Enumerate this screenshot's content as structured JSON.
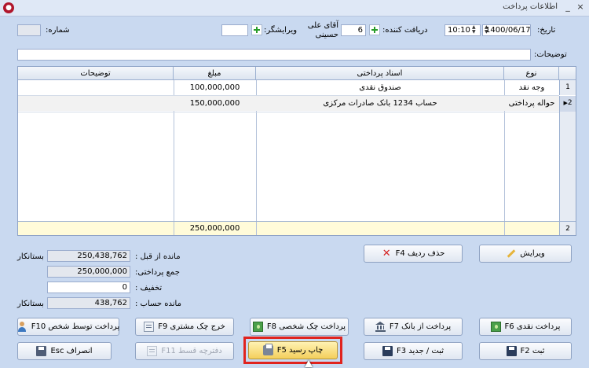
{
  "window": {
    "title": "اطلاعات پرداخت",
    "minimize": "_",
    "close": "×"
  },
  "header": {
    "number_label": "شماره:",
    "number_value": "",
    "editor_label": "ویرایشگر:",
    "editor_value": "",
    "receiver_label": "دریافت کننده:",
    "receiver_code": "6",
    "receiver_name_line1": "آقای علی",
    "receiver_name_line2": "حسینی",
    "date_label": "تاریخ:",
    "date_value": "1400/06/17",
    "time_value": "10:10",
    "description_label": "توضیحات:",
    "description_value": ""
  },
  "grid": {
    "columns": [
      "نوع",
      "اسناد پرداختی",
      "مبلغ",
      "توضیحات"
    ],
    "rows": [
      {
        "num": "1",
        "type": "وجه نقد",
        "doc": "صندوق نقدی",
        "amount": "100,000,000",
        "desc": ""
      },
      {
        "num": "2",
        "type": "حواله پرداختی",
        "doc": "حساب 1234 بانک صادرات مرکزی",
        "amount": "150,000,000",
        "desc": ""
      }
    ],
    "footer_count": "2",
    "footer_total": "250,000,000"
  },
  "summary": {
    "prev_balance_label": "مانده از قبل :",
    "prev_balance_value": "250,438,762",
    "prev_balance_status": "بستانکار",
    "total_paid_label": "جمع پرداختی:",
    "total_paid_value": "250,000,000",
    "discount_label": "تخفیف :",
    "discount_value": "0",
    "account_balance_label": "مانده حساب :",
    "account_balance_value": "438,762",
    "account_balance_status": "بستانکار"
  },
  "buttons": {
    "edit": "ویرایش",
    "delete_row": "حذف ردیف F4",
    "cash_payment": "پرداخت نقدی F6",
    "bank_payment": "پرداخت از بانک F7",
    "personal_check": "پرداخت چک شخصی F8",
    "customer_check": "خرج چک مشتری F9",
    "person_payment": "پرداخت توسط شخص F10",
    "register": "ثبت F2",
    "register_new": "ثبت / جدید F3",
    "print_receipt": "چاپ رسید F5",
    "installment_book": "دفترچه قسط F11",
    "cancel": "انصراف Esc"
  },
  "colors": {
    "background": "#c9d9f0",
    "footer_row": "#fffbd9",
    "highlight_border": "#e0231e",
    "highlight_button": "#f4cf5c"
  }
}
